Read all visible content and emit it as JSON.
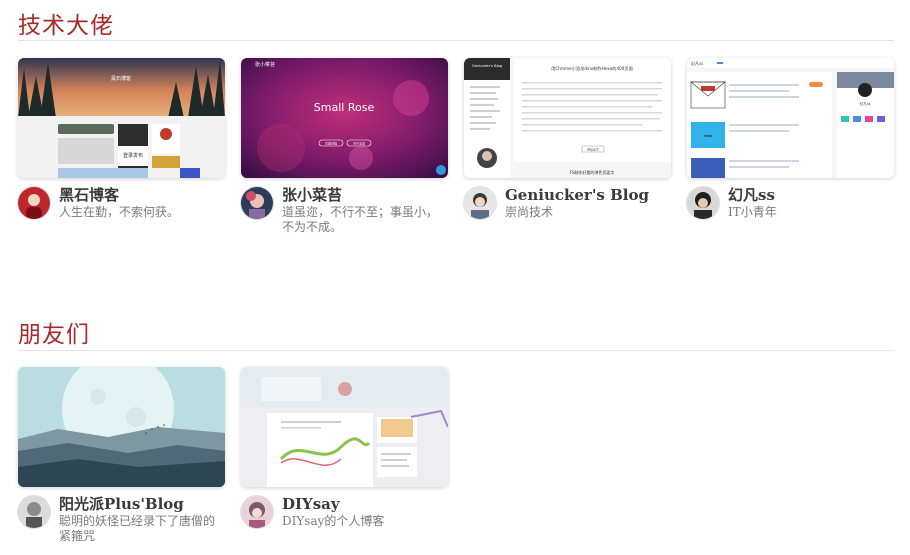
{
  "sections": [
    {
      "title": "技术大佬",
      "cards": [
        {
          "name": "黑石博客",
          "desc": "人生在勤，不索何获。"
        },
        {
          "name": "张小菜苔",
          "desc": "道虽迩，不行不至；事虽小，不为不成。"
        },
        {
          "name": "Geniucker's Blog",
          "desc": "崇尚技术"
        },
        {
          "name": "幻凡ss",
          "desc": "IT小青年"
        }
      ]
    },
    {
      "title": "朋友们",
      "cards": [
        {
          "name": "阳光派Plus'Blog",
          "desc": "聪明的妖怪已经录下了唐僧的紧箍咒"
        },
        {
          "name": "DIYsay",
          "desc": "DIYsay的个人博客"
        }
      ]
    }
  ],
  "screenshots": {
    "zhang": {
      "logo": "张小菜苔",
      "hero": "Small Rose",
      "btn1": "文章归档",
      "btn2": "关于本站"
    },
    "geniucker": {
      "title": "Geniucker's Blog",
      "post": "用Chrome小恐龙dino制作Hexo的404页面",
      "button": "阅读全文",
      "next": "FS制作好看的弹色页面字"
    },
    "huanfan": {
      "logo": "幻凡ss",
      "card": "幻凡ss"
    },
    "heishi": {
      "hero": "黑石博客",
      "sub": "登录发布"
    }
  },
  "colors": {
    "accent": "#a52a2a"
  }
}
